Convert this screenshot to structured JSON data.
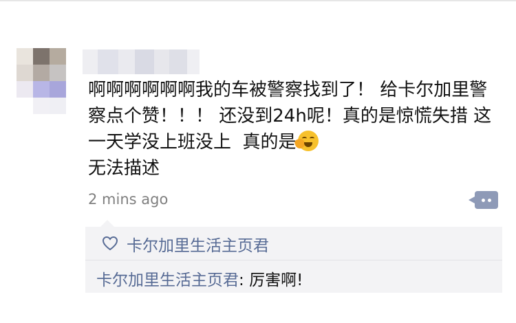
{
  "post": {
    "text_before_emoji": "啊啊啊啊啊啊我的车被警察找到了！ 给卡尔加里警察点个赞！！！ 还没到24h呢！真的是惊慌失措 这一天学没上班没上  真的是",
    "text_after_emoji": "无法描述",
    "emoji_icon": "face-with-hand-over-mouth-emoji",
    "timestamp": "2 mins ago",
    "action_icon": "comment-more-icon"
  },
  "likes": {
    "icon": "heart-outline-icon",
    "names": "卡尔加里生活主页君"
  },
  "comments": [
    {
      "author": "卡尔加里生活主页君",
      "separator": ": ",
      "text": "厉害啊!"
    }
  ],
  "colors": {
    "link": "#576b95",
    "text": "#111111",
    "muted": "#7f7f7f",
    "panel": "#f3f3f5",
    "action_button": "#8e9ab7"
  }
}
